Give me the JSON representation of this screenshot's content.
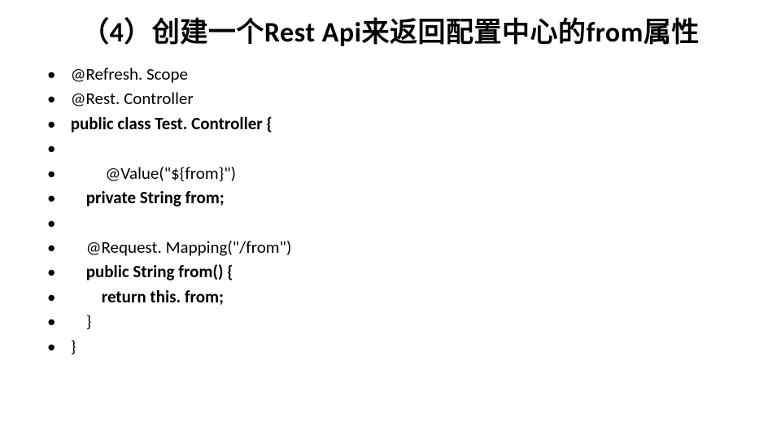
{
  "title": "（4）创建一个Rest Api来返回配置中心的from属性",
  "items": [
    {
      "prefix": " ",
      "plain": "@Refresh. Scope",
      "bold": ""
    },
    {
      "prefix": " ",
      "plain": "@Rest. Controller",
      "bold": ""
    },
    {
      "prefix": " ",
      "plain": "",
      "bold": "public class Test. Controller {"
    },
    {
      "prefix": "",
      "plain": "",
      "bold": ""
    },
    {
      "prefix": "          ",
      "plain": "@Value(\"${from}\")",
      "bold": ""
    },
    {
      "prefix": "     ",
      "plain": "",
      "bold": "private String from;"
    },
    {
      "prefix": "",
      "plain": "",
      "bold": ""
    },
    {
      "prefix": "     ",
      "plain": "@Request. Mapping(\"/from\")",
      "bold": ""
    },
    {
      "prefix": "     ",
      "plain": "",
      "bold": "public String from() {"
    },
    {
      "prefix": "         ",
      "plain": "",
      "bold": "return this. from;"
    },
    {
      "prefix": "     ",
      "plain": "}",
      "bold": ""
    },
    {
      "prefix": " ",
      "plain": "}",
      "bold": ""
    }
  ]
}
